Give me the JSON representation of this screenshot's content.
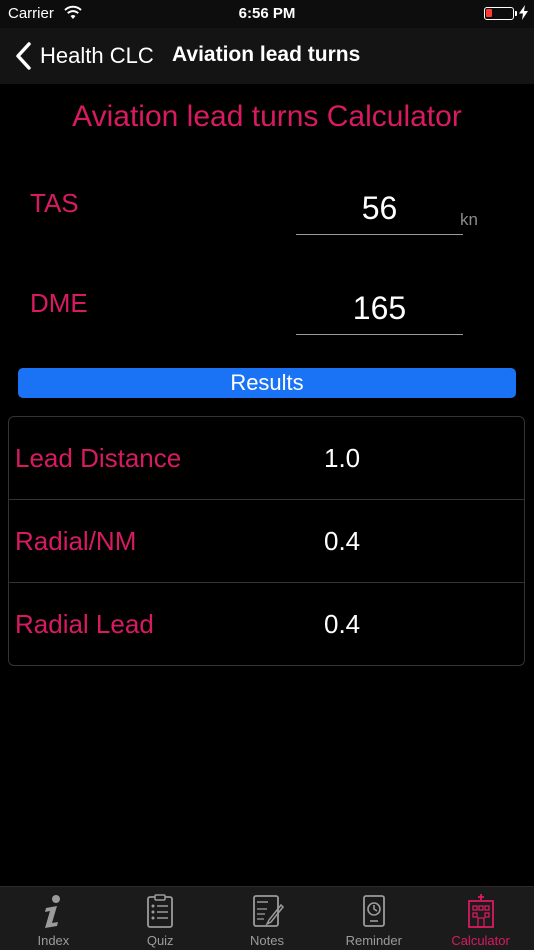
{
  "status_bar": {
    "carrier": "Carrier",
    "time": "6:56 PM",
    "battery_color": "#ff3b30"
  },
  "nav": {
    "back_label": "Health CLC",
    "title": "Aviation lead turns",
    "back_icon": "chevron-left-icon"
  },
  "calculator": {
    "title": "Aviation lead turns Calculator",
    "inputs": [
      {
        "label": "TAS",
        "value": "56",
        "unit": "kn"
      },
      {
        "label": "DME",
        "value": "165",
        "unit": ""
      }
    ],
    "results_button": "Results",
    "results": [
      {
        "label": "Lead Distance",
        "value": "1.0"
      },
      {
        "label": "Radial/NM",
        "value": "0.4"
      },
      {
        "label": "Radial Lead",
        "value": "0.4"
      }
    ]
  },
  "tabs": [
    {
      "label": "Index",
      "icon": "info-icon",
      "active": false
    },
    {
      "label": "Quiz",
      "icon": "clipboard-list-icon",
      "active": false
    },
    {
      "label": "Notes",
      "icon": "notes-icon",
      "active": false
    },
    {
      "label": "Reminder",
      "icon": "clock-device-icon",
      "active": false
    },
    {
      "label": "Calculator",
      "icon": "hospital-icon",
      "active": true
    }
  ],
  "colors": {
    "accent": "#d81b60",
    "button": "#1a73f5",
    "background": "#000000"
  }
}
